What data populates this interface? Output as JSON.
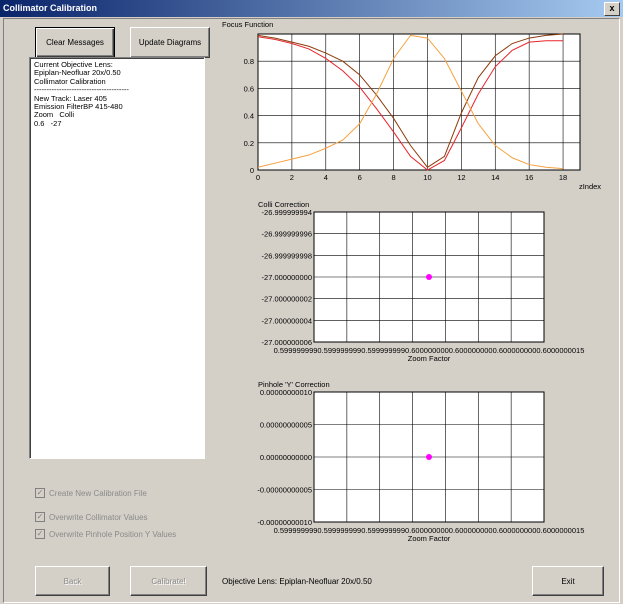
{
  "window": {
    "title": "Collimator Calibration",
    "close_label": "x"
  },
  "buttons": {
    "clear_messages": "Clear Messages",
    "update_diagrams": "Update Diagrams",
    "back": "Back",
    "calibrate": "Calibrate!",
    "exit": "Exit"
  },
  "messages": [
    "Current Objective Lens:",
    "Epiplan-Neofluar 20x/0.50",
    "Collimator Calibration",
    "--------------------------------------",
    "New Track: Laser 405",
    "Emission FilterBP 415-480",
    "Zoom   Colli",
    "0.6   -27"
  ],
  "checkboxes": [
    {
      "label": "Create New Calibration File",
      "checked": true,
      "enabled": false
    },
    {
      "label": "Overwrite Collimator Values",
      "checked": true,
      "enabled": false
    },
    {
      "label": "Overwrite Pinhole Position Y Values",
      "checked": true,
      "enabled": false
    }
  ],
  "status": "Objective Lens: Epiplan-Neofluar 20x/0.50",
  "chart_data": [
    {
      "type": "line",
      "title": "Focus Function",
      "xlabel": "zIndex",
      "ylabel": "",
      "xlim": [
        0,
        19
      ],
      "ylim": [
        0,
        1
      ],
      "x_ticks": [
        "0",
        "2",
        "4",
        "6",
        "8",
        "10",
        "12",
        "14",
        "16",
        "18"
      ],
      "y_ticks": [
        "0",
        "0.2",
        "0.4",
        "0.6",
        "0.8"
      ],
      "x": [
        0,
        1,
        2,
        3,
        4,
        5,
        6,
        7,
        8,
        9,
        10,
        11,
        12,
        13,
        14,
        15,
        16,
        17,
        18
      ],
      "series": [
        {
          "color": "#8b3a0a",
          "values": [
            0.99,
            0.97,
            0.94,
            0.91,
            0.86,
            0.8,
            0.7,
            0.55,
            0.38,
            0.18,
            0.02,
            0.1,
            0.42,
            0.68,
            0.84,
            0.93,
            0.97,
            0.99,
            1.0
          ]
        },
        {
          "color": "#e8232a",
          "values": [
            0.98,
            0.96,
            0.93,
            0.89,
            0.82,
            0.73,
            0.61,
            0.45,
            0.28,
            0.1,
            0.0,
            0.07,
            0.31,
            0.56,
            0.76,
            0.88,
            0.94,
            0.95,
            0.95
          ]
        },
        {
          "color": "#f5a040",
          "values": [
            0.02,
            0.05,
            0.08,
            0.11,
            0.16,
            0.22,
            0.34,
            0.56,
            0.82,
            0.99,
            0.97,
            0.82,
            0.58,
            0.34,
            0.18,
            0.09,
            0.04,
            0.02,
            0.01
          ]
        }
      ]
    },
    {
      "type": "scatter",
      "title": "Colli Correction",
      "xlabel": "Zoom Factor",
      "x_ticks": [
        "0.5999999990.5999999990.5999999990.6000000000.6000000000.6000000000.6000000015"
      ],
      "y_ticks": [
        "-26.999999994",
        "-26.999999996",
        "-26.999999998",
        "-27.000000000",
        "-27.000000002",
        "-27.000000004",
        "-27.000000006"
      ],
      "points": [
        {
          "x": 0.6,
          "y": -27.0
        }
      ],
      "point_color": "#ff00ff"
    },
    {
      "type": "scatter",
      "title": "Pinhole 'Y' Correction",
      "xlabel": "Zoom Factor",
      "x_ticks": [
        "0.5999999990.5999999990.5999999990.6000000000.6000000000.6000000000.6000000015"
      ],
      "y_ticks": [
        "0.00000000010",
        "0.00000000005",
        "0.00000000000",
        "-0.00000000005",
        "-0.00000000010"
      ],
      "points": [
        {
          "x": 0.6,
          "y": 0.0
        }
      ],
      "point_color": "#ff00ff"
    }
  ]
}
